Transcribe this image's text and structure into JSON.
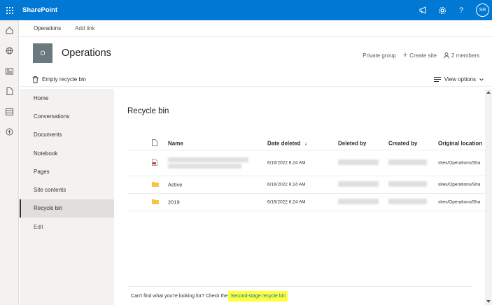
{
  "app": {
    "brand": "SharePoint",
    "avatar_initials": "SR"
  },
  "topbar": {
    "icons": [
      "waffle-icon",
      "megaphone-icon",
      "settings-icon",
      "help-icon"
    ]
  },
  "rail": {
    "icons": [
      "home-icon",
      "globe-icon",
      "news-icon",
      "file-icon",
      "list-icon",
      "add-icon"
    ]
  },
  "hubnav": {
    "items": [
      "Operations",
      "Add link"
    ]
  },
  "site": {
    "logo_letter": "O",
    "title": "Operations",
    "privacy": "Private group",
    "create_site": "Create site",
    "members": "2 members"
  },
  "command_bar": {
    "empty_recycle_bin": "Empty recycle bin",
    "view_options": "View options"
  },
  "leftnav": {
    "items": [
      "Home",
      "Conversations",
      "Documents",
      "Notebook",
      "Pages",
      "Site contents",
      "Recycle bin",
      "Edit"
    ],
    "active_index": 6
  },
  "main": {
    "title": "Recycle bin",
    "columns": {
      "name": "Name",
      "date_deleted": "Date deleted",
      "deleted_by": "Deleted by",
      "created_by": "Created by",
      "original_location": "Original location"
    },
    "rows": [
      {
        "type": "pdf",
        "name": "",
        "date_deleted": "6/16/2022 6:24 AM",
        "original_location": "sites/Operations/Sha"
      },
      {
        "type": "folder",
        "name": "Active",
        "date_deleted": "6/16/2022 6:24 AM",
        "original_location": "sites/Operations/Sha"
      },
      {
        "type": "folder",
        "name": "2019",
        "date_deleted": "6/16/2022 6:24 AM",
        "original_location": "sites/Operations/Sha"
      }
    ],
    "footer_text": "Can't find what you're looking for? Check the",
    "footer_link": "Second-stage recycle bin"
  },
  "colors": {
    "suite_bar": "#0078d4",
    "highlight": "#ffff3b",
    "folder": "#f8c441"
  }
}
